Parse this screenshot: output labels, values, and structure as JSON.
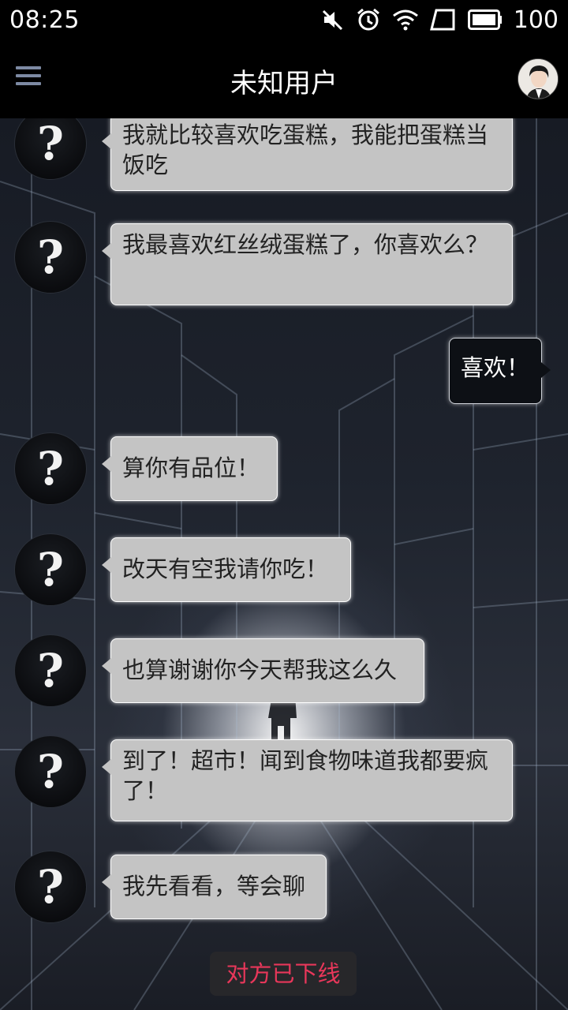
{
  "status_bar": {
    "time": "08:25",
    "battery": "100",
    "icons": [
      "mute-icon",
      "alarm-icon",
      "wifi-icon",
      "signal-icon",
      "battery-icon"
    ]
  },
  "header": {
    "title": "未知用户",
    "menu_icon": "hamburger-menu-icon",
    "avatar_icon": "user-avatar"
  },
  "messages": [
    {
      "side": "left",
      "text": "我就比较喜欢吃蛋糕，我能把蛋糕当饭吃"
    },
    {
      "side": "left",
      "text": "我最喜欢红丝绒蛋糕了，你喜欢么？"
    },
    {
      "side": "right",
      "text": "喜欢！"
    },
    {
      "side": "left",
      "text": "算你有品位！"
    },
    {
      "side": "left",
      "text": "改天有空我请你吃！"
    },
    {
      "side": "left",
      "text": "也算谢谢你今天帮我这么久"
    },
    {
      "side": "left",
      "text": "到了！超市！闻到食物味道我都要疯了！"
    },
    {
      "side": "left",
      "text": "我先看看，等会聊"
    }
  ],
  "unknown_avatar_glyph": "?",
  "offline_notice": "对方已下线",
  "colors": {
    "accent_offline": "#e8375a",
    "bubble_left": "#c4c4c4",
    "bubble_right": "#0d1015"
  }
}
